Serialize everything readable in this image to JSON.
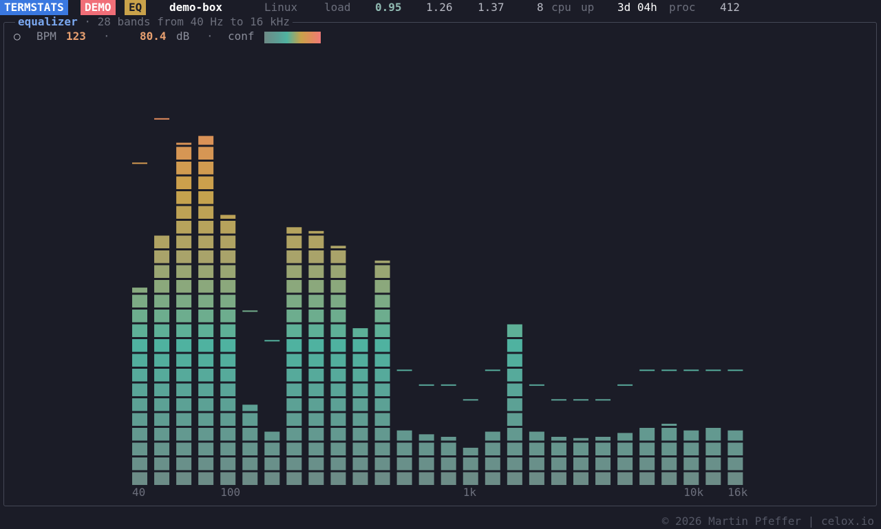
{
  "header": {
    "app_badge": "TERMSTATS",
    "demo_badge": "DEMO",
    "eq_badge": "EQ",
    "host": "demo-box",
    "os": "Linux",
    "load_label": "load",
    "load1": "0.95",
    "load5": "1.26",
    "load15": "1.37",
    "cpu_count": "8",
    "cpu_label": "cpu",
    "up_label": "up",
    "uptime": "3d 04h",
    "proc_label": "proc",
    "proc_count": "412",
    "colors": {
      "app": "#3a78e0",
      "demo": "#f06e78",
      "eq": "#c9a24a"
    }
  },
  "panel": {
    "title": "equalizer",
    "subtitle": "· 28 bands from 40 Hz to 16 kHz",
    "status_icon": "circle-outline-icon",
    "bpm_label": "BPM",
    "bpm_value": "123",
    "sep": "·",
    "db_value": "80.4",
    "db_unit": "dB",
    "conf_label": "conf"
  },
  "chart_data": {
    "type": "bar",
    "band_count": 28,
    "x_tick_labels": [
      "40",
      "100",
      "1k",
      "10k",
      "16k"
    ],
    "x_tick_band_index": [
      0,
      4,
      15,
      25,
      27
    ],
    "max_level_cells": 25,
    "levels": [
      13.4,
      17.0,
      23.1,
      23.7,
      18.3,
      5.5,
      3.7,
      17.5,
      17.2,
      16.2,
      10.7,
      15.2,
      3.8,
      3.5,
      3.3,
      2.6,
      3.7,
      11.0,
      3.7,
      3.3,
      3.2,
      3.3,
      3.6,
      4.0,
      4.1,
      3.8,
      4.0,
      3.8
    ],
    "peaks": [
      21.8,
      24.8,
      23.0,
      23.7,
      18.3,
      11.8,
      9.8,
      17.5,
      17.2,
      16.2,
      10.7,
      15.2,
      7.8,
      6.8,
      6.8,
      5.8,
      7.8,
      11.0,
      6.8,
      5.8,
      5.8,
      5.8,
      6.8,
      7.8,
      7.8,
      7.8,
      7.8,
      7.8
    ],
    "color_scale": [
      "#6e8a86",
      "#4fb2a0",
      "#a9a36a",
      "#c9a24a",
      "#e38a5e"
    ]
  },
  "footer": {
    "copyright": "© 2026 Martin Pfeffer | celox.io"
  }
}
